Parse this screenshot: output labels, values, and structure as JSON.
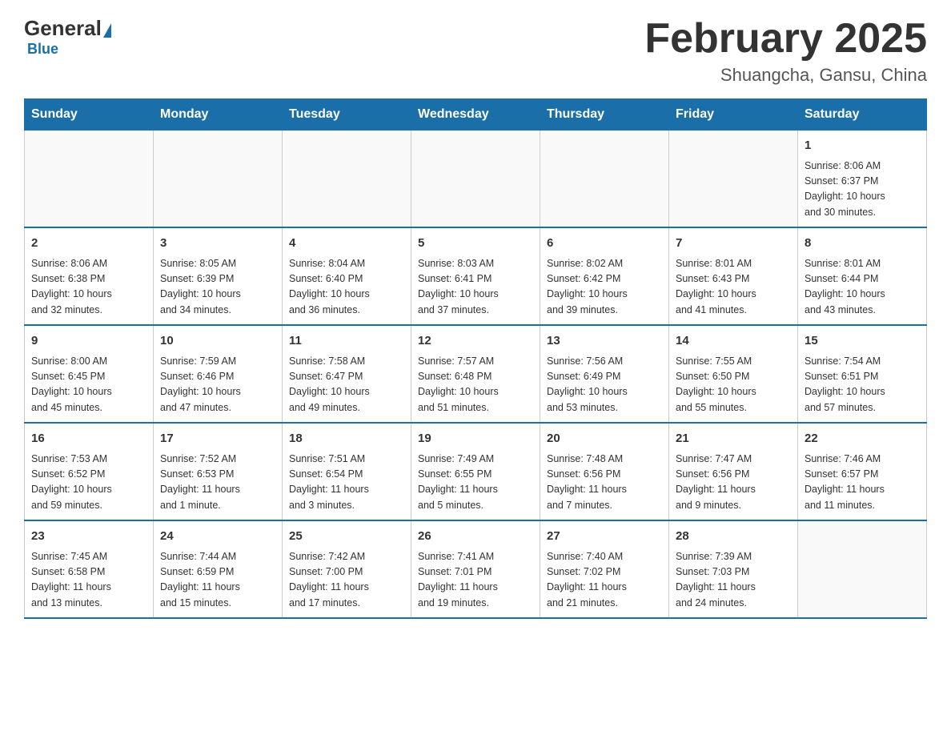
{
  "header": {
    "logo_general": "General",
    "logo_blue": "Blue",
    "month_title": "February 2025",
    "location": "Shuangcha, Gansu, China"
  },
  "weekdays": [
    "Sunday",
    "Monday",
    "Tuesday",
    "Wednesday",
    "Thursday",
    "Friday",
    "Saturday"
  ],
  "weeks": [
    [
      {
        "day": "",
        "info": ""
      },
      {
        "day": "",
        "info": ""
      },
      {
        "day": "",
        "info": ""
      },
      {
        "day": "",
        "info": ""
      },
      {
        "day": "",
        "info": ""
      },
      {
        "day": "",
        "info": ""
      },
      {
        "day": "1",
        "info": "Sunrise: 8:06 AM\nSunset: 6:37 PM\nDaylight: 10 hours\nand 30 minutes."
      }
    ],
    [
      {
        "day": "2",
        "info": "Sunrise: 8:06 AM\nSunset: 6:38 PM\nDaylight: 10 hours\nand 32 minutes."
      },
      {
        "day": "3",
        "info": "Sunrise: 8:05 AM\nSunset: 6:39 PM\nDaylight: 10 hours\nand 34 minutes."
      },
      {
        "day": "4",
        "info": "Sunrise: 8:04 AM\nSunset: 6:40 PM\nDaylight: 10 hours\nand 36 minutes."
      },
      {
        "day": "5",
        "info": "Sunrise: 8:03 AM\nSunset: 6:41 PM\nDaylight: 10 hours\nand 37 minutes."
      },
      {
        "day": "6",
        "info": "Sunrise: 8:02 AM\nSunset: 6:42 PM\nDaylight: 10 hours\nand 39 minutes."
      },
      {
        "day": "7",
        "info": "Sunrise: 8:01 AM\nSunset: 6:43 PM\nDaylight: 10 hours\nand 41 minutes."
      },
      {
        "day": "8",
        "info": "Sunrise: 8:01 AM\nSunset: 6:44 PM\nDaylight: 10 hours\nand 43 minutes."
      }
    ],
    [
      {
        "day": "9",
        "info": "Sunrise: 8:00 AM\nSunset: 6:45 PM\nDaylight: 10 hours\nand 45 minutes."
      },
      {
        "day": "10",
        "info": "Sunrise: 7:59 AM\nSunset: 6:46 PM\nDaylight: 10 hours\nand 47 minutes."
      },
      {
        "day": "11",
        "info": "Sunrise: 7:58 AM\nSunset: 6:47 PM\nDaylight: 10 hours\nand 49 minutes."
      },
      {
        "day": "12",
        "info": "Sunrise: 7:57 AM\nSunset: 6:48 PM\nDaylight: 10 hours\nand 51 minutes."
      },
      {
        "day": "13",
        "info": "Sunrise: 7:56 AM\nSunset: 6:49 PM\nDaylight: 10 hours\nand 53 minutes."
      },
      {
        "day": "14",
        "info": "Sunrise: 7:55 AM\nSunset: 6:50 PM\nDaylight: 10 hours\nand 55 minutes."
      },
      {
        "day": "15",
        "info": "Sunrise: 7:54 AM\nSunset: 6:51 PM\nDaylight: 10 hours\nand 57 minutes."
      }
    ],
    [
      {
        "day": "16",
        "info": "Sunrise: 7:53 AM\nSunset: 6:52 PM\nDaylight: 10 hours\nand 59 minutes."
      },
      {
        "day": "17",
        "info": "Sunrise: 7:52 AM\nSunset: 6:53 PM\nDaylight: 11 hours\nand 1 minute."
      },
      {
        "day": "18",
        "info": "Sunrise: 7:51 AM\nSunset: 6:54 PM\nDaylight: 11 hours\nand 3 minutes."
      },
      {
        "day": "19",
        "info": "Sunrise: 7:49 AM\nSunset: 6:55 PM\nDaylight: 11 hours\nand 5 minutes."
      },
      {
        "day": "20",
        "info": "Sunrise: 7:48 AM\nSunset: 6:56 PM\nDaylight: 11 hours\nand 7 minutes."
      },
      {
        "day": "21",
        "info": "Sunrise: 7:47 AM\nSunset: 6:56 PM\nDaylight: 11 hours\nand 9 minutes."
      },
      {
        "day": "22",
        "info": "Sunrise: 7:46 AM\nSunset: 6:57 PM\nDaylight: 11 hours\nand 11 minutes."
      }
    ],
    [
      {
        "day": "23",
        "info": "Sunrise: 7:45 AM\nSunset: 6:58 PM\nDaylight: 11 hours\nand 13 minutes."
      },
      {
        "day": "24",
        "info": "Sunrise: 7:44 AM\nSunset: 6:59 PM\nDaylight: 11 hours\nand 15 minutes."
      },
      {
        "day": "25",
        "info": "Sunrise: 7:42 AM\nSunset: 7:00 PM\nDaylight: 11 hours\nand 17 minutes."
      },
      {
        "day": "26",
        "info": "Sunrise: 7:41 AM\nSunset: 7:01 PM\nDaylight: 11 hours\nand 19 minutes."
      },
      {
        "day": "27",
        "info": "Sunrise: 7:40 AM\nSunset: 7:02 PM\nDaylight: 11 hours\nand 21 minutes."
      },
      {
        "day": "28",
        "info": "Sunrise: 7:39 AM\nSunset: 7:03 PM\nDaylight: 11 hours\nand 24 minutes."
      },
      {
        "day": "",
        "info": ""
      }
    ]
  ]
}
